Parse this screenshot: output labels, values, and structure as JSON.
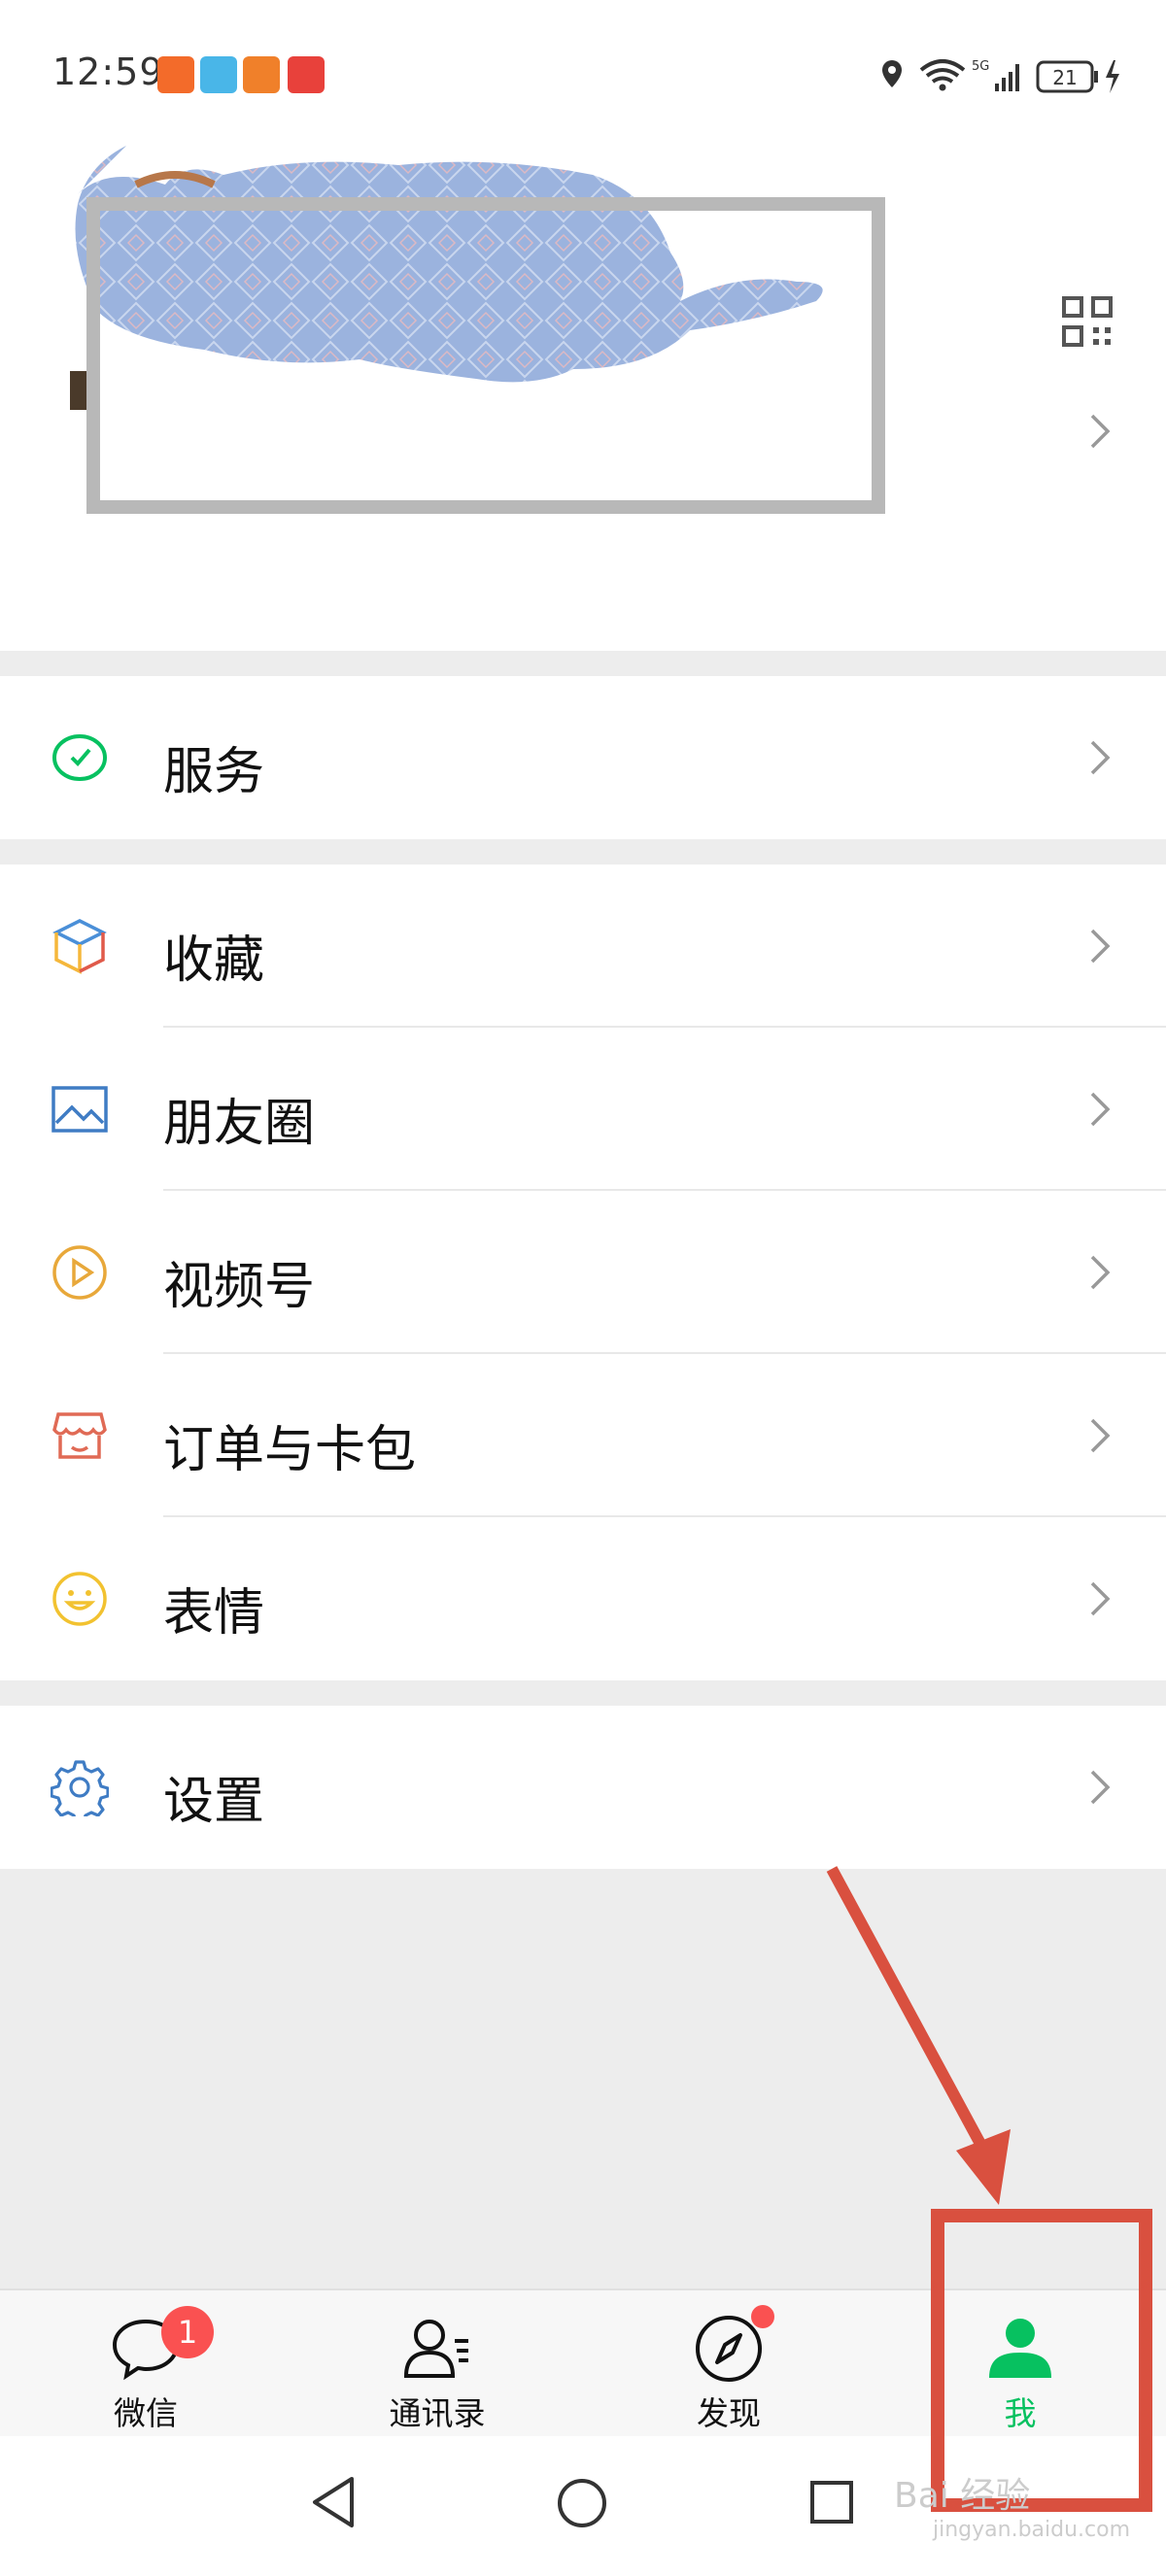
{
  "status_bar": {
    "time": "12:59",
    "battery": "21",
    "network": "5G",
    "icons": [
      "location-icon",
      "wifi-icon",
      "signal-icon",
      "battery-icon",
      "charging-icon"
    ],
    "app_icons": [
      "kuaishou-icon",
      "reader-icon",
      "kuaishou-lite-icon",
      "video-icon"
    ]
  },
  "profile": {
    "qr_icon": "qr-code-icon",
    "redacted": true
  },
  "menu": {
    "services": {
      "label": "服务",
      "icon": "wechat-pay-icon"
    },
    "favorites": {
      "label": "收藏",
      "icon": "cube-icon"
    },
    "moments": {
      "label": "朋友圈",
      "icon": "image-icon"
    },
    "channels": {
      "label": "视频号",
      "icon": "play-circle-icon"
    },
    "orders": {
      "label": "订单与卡包",
      "icon": "shop-icon"
    },
    "stickers": {
      "label": "表情",
      "icon": "smile-icon"
    },
    "settings": {
      "label": "设置",
      "icon": "gear-icon"
    }
  },
  "tabbar": {
    "tabs": [
      {
        "label": "微信",
        "icon": "chat-bubble-icon",
        "badge": "1"
      },
      {
        "label": "通讯录",
        "icon": "contacts-icon"
      },
      {
        "label": "发现",
        "icon": "compass-icon"
      },
      {
        "label": "我",
        "icon": "person-icon",
        "active": true
      }
    ]
  },
  "watermark": {
    "brand": "Bai 经验",
    "url": "jingyan.baidu.com"
  },
  "colors": {
    "accent_green": "#07c160",
    "badge_red": "#fa5151",
    "annotation_red": "#d9503f"
  }
}
